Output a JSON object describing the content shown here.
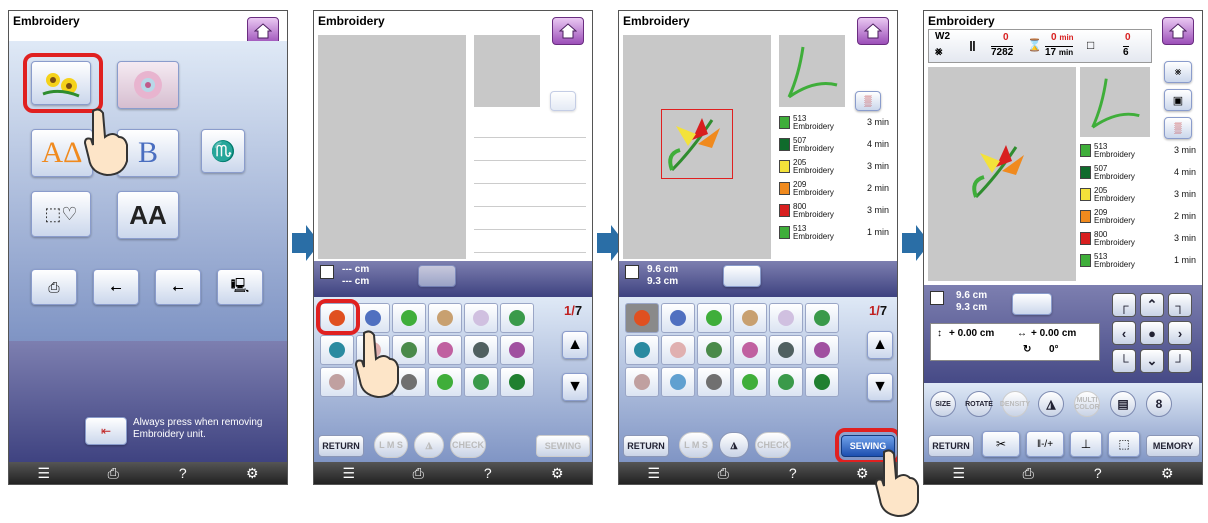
{
  "screen_title": "Embroidery",
  "footer_icons": [
    "list-icon",
    "machine-icon",
    "help-icon",
    "settings-icon"
  ],
  "footer_help": "?",
  "panel1": {
    "notice": "Always press when removing Embroidery unit."
  },
  "panel2": {
    "size_w": "--- cm",
    "size_h": "--- cm",
    "page_num": "1",
    "page_den": "7",
    "return": "RETURN",
    "lms": "L M S",
    "check": "CHECK",
    "sewing": "SEWING"
  },
  "panel3": {
    "size_w": "9.6 cm",
    "size_h": "9.3 cm",
    "page_num": "1",
    "page_den": "7",
    "return": "RETURN",
    "lms": "L M S",
    "check": "CHECK",
    "sewing": "SEWING"
  },
  "threads": [
    {
      "code": "513",
      "name": "Embroidery",
      "time": "3 min",
      "color": "#3fae3a"
    },
    {
      "code": "507",
      "name": "Embroidery",
      "time": "4 min",
      "color": "#0f6b2c"
    },
    {
      "code": "205",
      "name": "Embroidery",
      "time": "3 min",
      "color": "#f3e23a"
    },
    {
      "code": "209",
      "name": "Embroidery",
      "time": "2 min",
      "color": "#f08a1e"
    },
    {
      "code": "800",
      "name": "Embroidery",
      "time": "3 min",
      "color": "#d81f1f"
    },
    {
      "code": "513",
      "name": "Embroidery",
      "time": "1 min",
      "color": "#3fae3a"
    }
  ],
  "panel4": {
    "foot": "W2",
    "stitch_done": "0",
    "stitch_total": "7282",
    "time_done": "0",
    "time_total": "17",
    "time_unit": "min",
    "color_done": "0",
    "color_total": "6",
    "size_w": "9.6 cm",
    "size_h": "9.3 cm",
    "offset_v": "+ 0.00 cm",
    "offset_h": "+ 0.00 cm",
    "angle": "0°",
    "size_btn": "SIZE",
    "rotate_btn": "ROTATE",
    "density_btn": "DENSITY",
    "multi_btn": "MULTI COLOR",
    "return": "RETURN",
    "memory": "MEMORY"
  }
}
